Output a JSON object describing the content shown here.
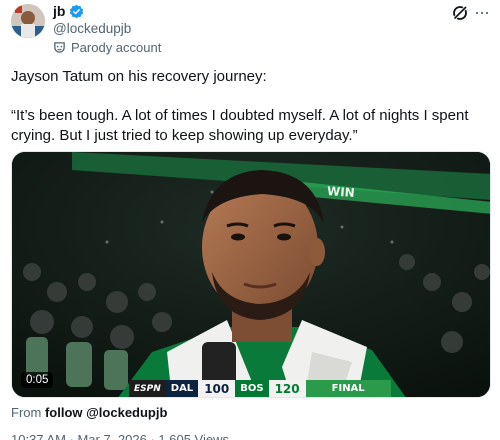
{
  "author": {
    "display_name": "jb",
    "handle": "@lockedupjb",
    "label": "Parody account"
  },
  "tweet": {
    "line1": "Jayson Tatum on his recovery journey:",
    "line2": "“It’s been tough. A lot of times I doubted myself. A lot of nights I spent crying. But I just tried to keep showing up everyday.”"
  },
  "video": {
    "duration": "0:05",
    "scorebug": {
      "network": "ESPN",
      "team1": "DAL",
      "score1": "100",
      "team2": "BOS",
      "score2": "120",
      "status": "FINAL"
    },
    "arena_sign": "WIN"
  },
  "source": {
    "prefix": "From",
    "text": "follow @lockedupjb"
  },
  "timestamp": "10:37 AM · Mar 7, 2026 · 1,605 Views",
  "colors": {
    "verified": "#1d9bf0",
    "celtics_green": "#007a33",
    "mavs_navy": "#0c2340"
  },
  "icons": [
    "verified-badge-icon",
    "parody-mask-icon",
    "grok-icon",
    "more-icon"
  ]
}
